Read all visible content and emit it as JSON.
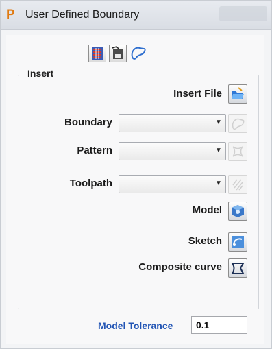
{
  "window": {
    "title": "User Defined Boundary",
    "app_icon": "P"
  },
  "toolbar": {
    "icons": [
      "boundary-layers-icon",
      "save-boundary-icon",
      "boundary-shape-icon"
    ]
  },
  "insert": {
    "group_label": "Insert",
    "insert_file_label": "Insert File",
    "boundary_label": "Boundary",
    "boundary_value": "",
    "pattern_label": "Pattern",
    "pattern_value": "",
    "toolpath_label": "Toolpath",
    "toolpath_value": "",
    "model_label": "Model",
    "sketch_label": "Sketch",
    "composite_curve_label": "Composite curve"
  },
  "model_tolerance": {
    "label": "Model Tolerance",
    "value": "0.1"
  },
  "colors": {
    "accent": "#2255b5",
    "app_icon": "#e07a12"
  }
}
